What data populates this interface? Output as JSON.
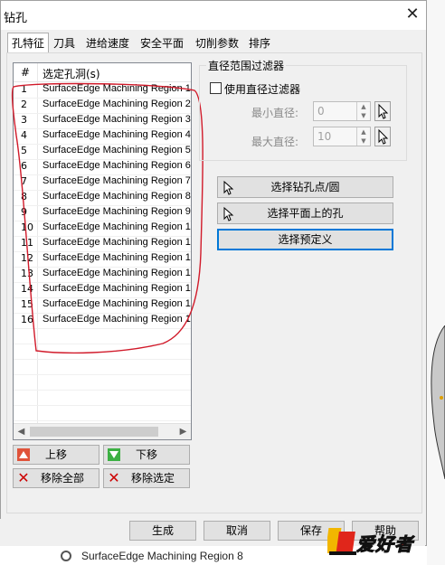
{
  "window": {
    "title": "钻孔"
  },
  "tabs": [
    "孔特征",
    "刀具",
    "进给速度",
    "安全平面",
    "切削参数",
    "排序"
  ],
  "list": {
    "headers": [
      "#",
      "选定孔洞(s)"
    ],
    "rows": [
      {
        "n": "1",
        "t": "SurfaceEdge Machining Region 1"
      },
      {
        "n": "2",
        "t": "SurfaceEdge Machining Region 2"
      },
      {
        "n": "3",
        "t": "SurfaceEdge Machining Region 3"
      },
      {
        "n": "4",
        "t": "SurfaceEdge Machining Region 4"
      },
      {
        "n": "5",
        "t": "SurfaceEdge Machining Region 5"
      },
      {
        "n": "6",
        "t": "SurfaceEdge Machining Region 6"
      },
      {
        "n": "7",
        "t": "SurfaceEdge Machining Region 7"
      },
      {
        "n": "8",
        "t": "SurfaceEdge Machining Region 8"
      },
      {
        "n": "9",
        "t": "SurfaceEdge Machining Region 9"
      },
      {
        "n": "10",
        "t": "SurfaceEdge Machining Region 1"
      },
      {
        "n": "11",
        "t": "SurfaceEdge Machining Region 1"
      },
      {
        "n": "12",
        "t": "SurfaceEdge Machining Region 1"
      },
      {
        "n": "13",
        "t": "SurfaceEdge Machining Region 1"
      },
      {
        "n": "14",
        "t": "SurfaceEdge Machining Region 1"
      },
      {
        "n": "15",
        "t": "SurfaceEdge Machining Region 1"
      },
      {
        "n": "16",
        "t": "SurfaceEdge Machining Region 1"
      }
    ]
  },
  "list_buttons": {
    "move_up": "上移",
    "move_down": "下移",
    "remove_all": "移除全部",
    "remove_selected": "移除选定"
  },
  "filter": {
    "group_label": "直径范围过滤器",
    "use_filter": "使用直径过滤器",
    "min_label": "最小直径:",
    "min_value": "0",
    "max_label": "最大直径:",
    "max_value": "10"
  },
  "select_buttons": {
    "pick_points": "选择钻孔点/圆",
    "pick_plane": "选择平面上的孔",
    "predefined": "选择预定义"
  },
  "footer": {
    "generate": "生成",
    "cancel": "取消",
    "save": "保存",
    "help": "帮助"
  },
  "background_text": "SurfaceEdge Machining Region 8",
  "watermark": "爱好者",
  "colors": {
    "annotation": "#d11a2a",
    "focus": "#0078d7",
    "up_icon": "#e0533a",
    "down_icon": "#3cb043"
  }
}
